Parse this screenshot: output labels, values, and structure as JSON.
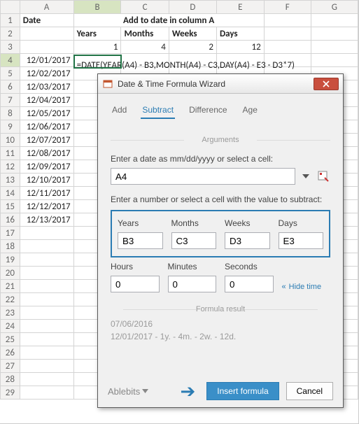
{
  "columns": [
    "A",
    "B",
    "C",
    "D",
    "E",
    "F",
    "G"
  ],
  "rows": [
    "1",
    "2",
    "3",
    "4",
    "5",
    "6",
    "7",
    "8",
    "9",
    "10",
    "11",
    "12",
    "13",
    "14",
    "15",
    "16",
    "17",
    "18",
    "19",
    "20",
    "21",
    "22",
    "23",
    "24",
    "25",
    "26",
    "27",
    "28",
    "29"
  ],
  "header": {
    "a1": "Date",
    "title": "Add to date in column A",
    "b2": "Years",
    "c2": "Months",
    "d2": "Weeks",
    "e2": "Days"
  },
  "row3": {
    "b": "1",
    "c": "4",
    "d": "2",
    "e": "12"
  },
  "dates": [
    "12/01/2017",
    "12/02/2017",
    "12/03/2017",
    "12/04/2017",
    "12/05/2017",
    "12/06/2017",
    "12/07/2017",
    "12/08/2017",
    "12/09/2017",
    "12/10/2017",
    "12/11/2017",
    "12/12/2017",
    "12/13/2017"
  ],
  "formula": "=DATE(YEAR(A4) - B3,MONTH(A4) - C3,DAY(A4) - E3 - D3*7)",
  "dialog": {
    "title": "Date & Time Formula Wizard",
    "tabs": {
      "add": "Add",
      "subtract": "Subtract",
      "difference": "Difference",
      "age": "Age"
    },
    "active_tab": "subtract",
    "arguments_label": "Arguments",
    "date_label": "Enter a date as mm/dd/yyyy or select a cell:",
    "date_value": "A4",
    "subtract_label": "Enter a number or select a cell with the value to subtract:",
    "years": {
      "label": "Years",
      "value": "B3"
    },
    "months": {
      "label": "Months",
      "value": "C3"
    },
    "weeks": {
      "label": "Weeks",
      "value": "D3"
    },
    "days": {
      "label": "Days",
      "value": "E3"
    },
    "hours": {
      "label": "Hours",
      "value": "0"
    },
    "minutes": {
      "label": "Minutes",
      "value": "0"
    },
    "seconds": {
      "label": "Seconds",
      "value": "0"
    },
    "hide_time": "Hide time",
    "result_label": "Formula result",
    "result_line1": "07/06/2016",
    "result_line2": "12/01/2017 - 1y. - 4m. - 2w. - 12d.",
    "brand": "Ablebits",
    "insert": "Insert formula",
    "cancel": "Cancel"
  }
}
